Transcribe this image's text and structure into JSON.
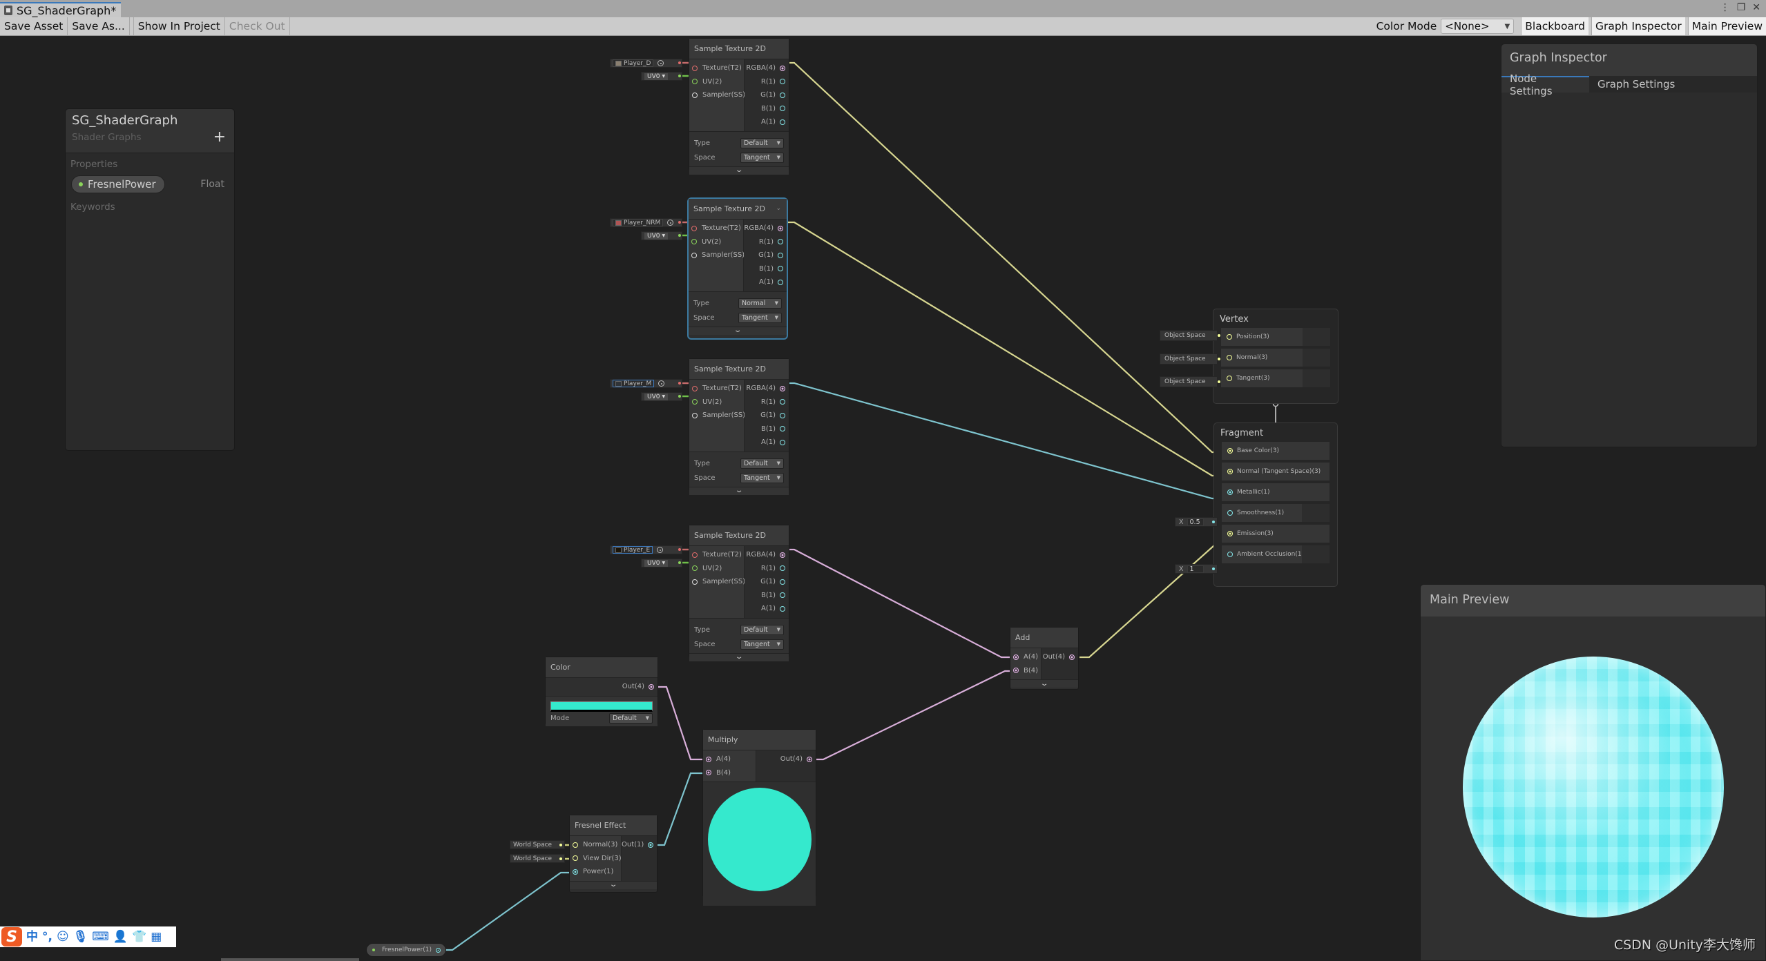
{
  "window": {
    "tab_title": "SG_ShaderGraph*",
    "controls": [
      "⋮",
      "❐",
      "✕"
    ]
  },
  "toolbar": {
    "save_asset": "Save Asset",
    "save_as": "Save As...",
    "show_in_project": "Show In Project",
    "check_out": "Check Out",
    "color_mode_label": "Color Mode",
    "color_mode_value": "<None>",
    "blackboard": "Blackboard",
    "graph_inspector": "Graph Inspector",
    "main_preview": "Main Preview"
  },
  "blackboard": {
    "title": "SG_ShaderGraph",
    "subtitle": "Shader Graphs",
    "add_symbol": "+",
    "properties_label": "Properties",
    "property": {
      "name": "FresnelPower",
      "type": "Float"
    },
    "keywords_label": "Keywords"
  },
  "sample_texture_nodes": [
    {
      "title": "Sample Texture 2D",
      "texture": "Player_D",
      "swatch": "#8a7f70",
      "uv": "UV0",
      "inputs": [
        "Texture(T2)",
        "UV(2)",
        "Sampler(SS)"
      ],
      "outputs": [
        "RGBA(4)",
        "R(1)",
        "G(1)",
        "B(1)",
        "A(1)"
      ],
      "type_label": "Type",
      "type": "Default",
      "space_label": "Space",
      "space": "Tangent"
    },
    {
      "title": "Sample Texture 2D",
      "texture": "Player_NRM",
      "swatch": "#b05555",
      "uv": "UV0",
      "inputs": [
        "Texture(T2)",
        "UV(2)",
        "Sampler(SS)"
      ],
      "outputs": [
        "RGBA(4)",
        "R(1)",
        "G(1)",
        "B(1)",
        "A(1)"
      ],
      "type_label": "Type",
      "type": "Normal",
      "space_label": "Space",
      "space": "Tangent"
    },
    {
      "title": "Sample Texture 2D",
      "texture": "Player_M",
      "swatch": "#303438",
      "uv": "UV0",
      "inputs": [
        "Texture(T2)",
        "UV(2)",
        "Sampler(SS)"
      ],
      "outputs": [
        "RGBA(4)",
        "R(1)",
        "G(1)",
        "B(1)",
        "A(1)"
      ],
      "type_label": "Type",
      "type": "Default",
      "space_label": "Space",
      "space": "Tangent"
    },
    {
      "title": "Sample Texture 2D",
      "texture": "Player_E",
      "swatch": "#1a1408",
      "uv": "UV0",
      "inputs": [
        "Texture(T2)",
        "UV(2)",
        "Sampler(SS)"
      ],
      "outputs": [
        "RGBA(4)",
        "R(1)",
        "G(1)",
        "B(1)",
        "A(1)"
      ],
      "type_label": "Type",
      "type": "Default",
      "space_label": "Space",
      "space": "Tangent"
    }
  ],
  "vertex": {
    "title": "Vertex",
    "blocks": [
      {
        "label": "Position(3)",
        "input": "Object Space"
      },
      {
        "label": "Normal(3)",
        "input": "Object Space"
      },
      {
        "label": "Tangent(3)",
        "input": "Object Space"
      }
    ]
  },
  "fragment": {
    "title": "Fragment",
    "blocks": [
      {
        "label": "Base Color(3)",
        "input": ""
      },
      {
        "label": "Normal (Tangent Space)(3)",
        "input": ""
      },
      {
        "label": "Metallic(1)",
        "input": ""
      },
      {
        "label": "Smoothness(1)",
        "input_label": "X",
        "input": "0.5"
      },
      {
        "label": "Emission(3)",
        "input": ""
      },
      {
        "label": "Ambient Occlusion(1)",
        "input_label": "X",
        "input": "1"
      }
    ]
  },
  "color_node": {
    "title": "Color",
    "output": "Out(4)",
    "color": "#35e9cd",
    "mode_label": "Mode",
    "mode": "Default"
  },
  "multiply_node": {
    "title": "Multiply",
    "inputs": [
      "A(4)",
      "B(4)"
    ],
    "output": "Out(4)",
    "preview_color": "#35e9cd"
  },
  "add_node": {
    "title": "Add",
    "inputs": [
      "A(4)",
      "B(4)"
    ],
    "output": "Out(4)"
  },
  "fresnel_node": {
    "title": "Fresnel Effect",
    "inputs": [
      "Normal(3)",
      "View Dir(3)",
      "Power(1)"
    ],
    "input_defaults": [
      "World Space",
      "World Space"
    ],
    "output": "Out(1)"
  },
  "property_node": {
    "label": "FresnelPower(1)"
  },
  "graph_inspector": {
    "title": "Graph Inspector",
    "tabs": [
      "Node Settings",
      "Graph Settings"
    ],
    "active_tab": "Node Settings"
  },
  "main_preview": {
    "title": "Main Preview"
  },
  "watermark": "CSDN @Unity李大馋师",
  "ime_bar": {
    "icons": [
      "sogou-logo",
      "中",
      "°,",
      "☺",
      "🎤",
      "⌨",
      "👤",
      "👕",
      "▦"
    ]
  },
  "colors": {
    "texture_port": "#e06b6b",
    "uv_port": "#8bd45b",
    "vector4_port": "#e3b4e6",
    "vector1_port": "#84e4e7",
    "vector3_port": "#f6ff9a",
    "selection": "#3a79bb"
  }
}
